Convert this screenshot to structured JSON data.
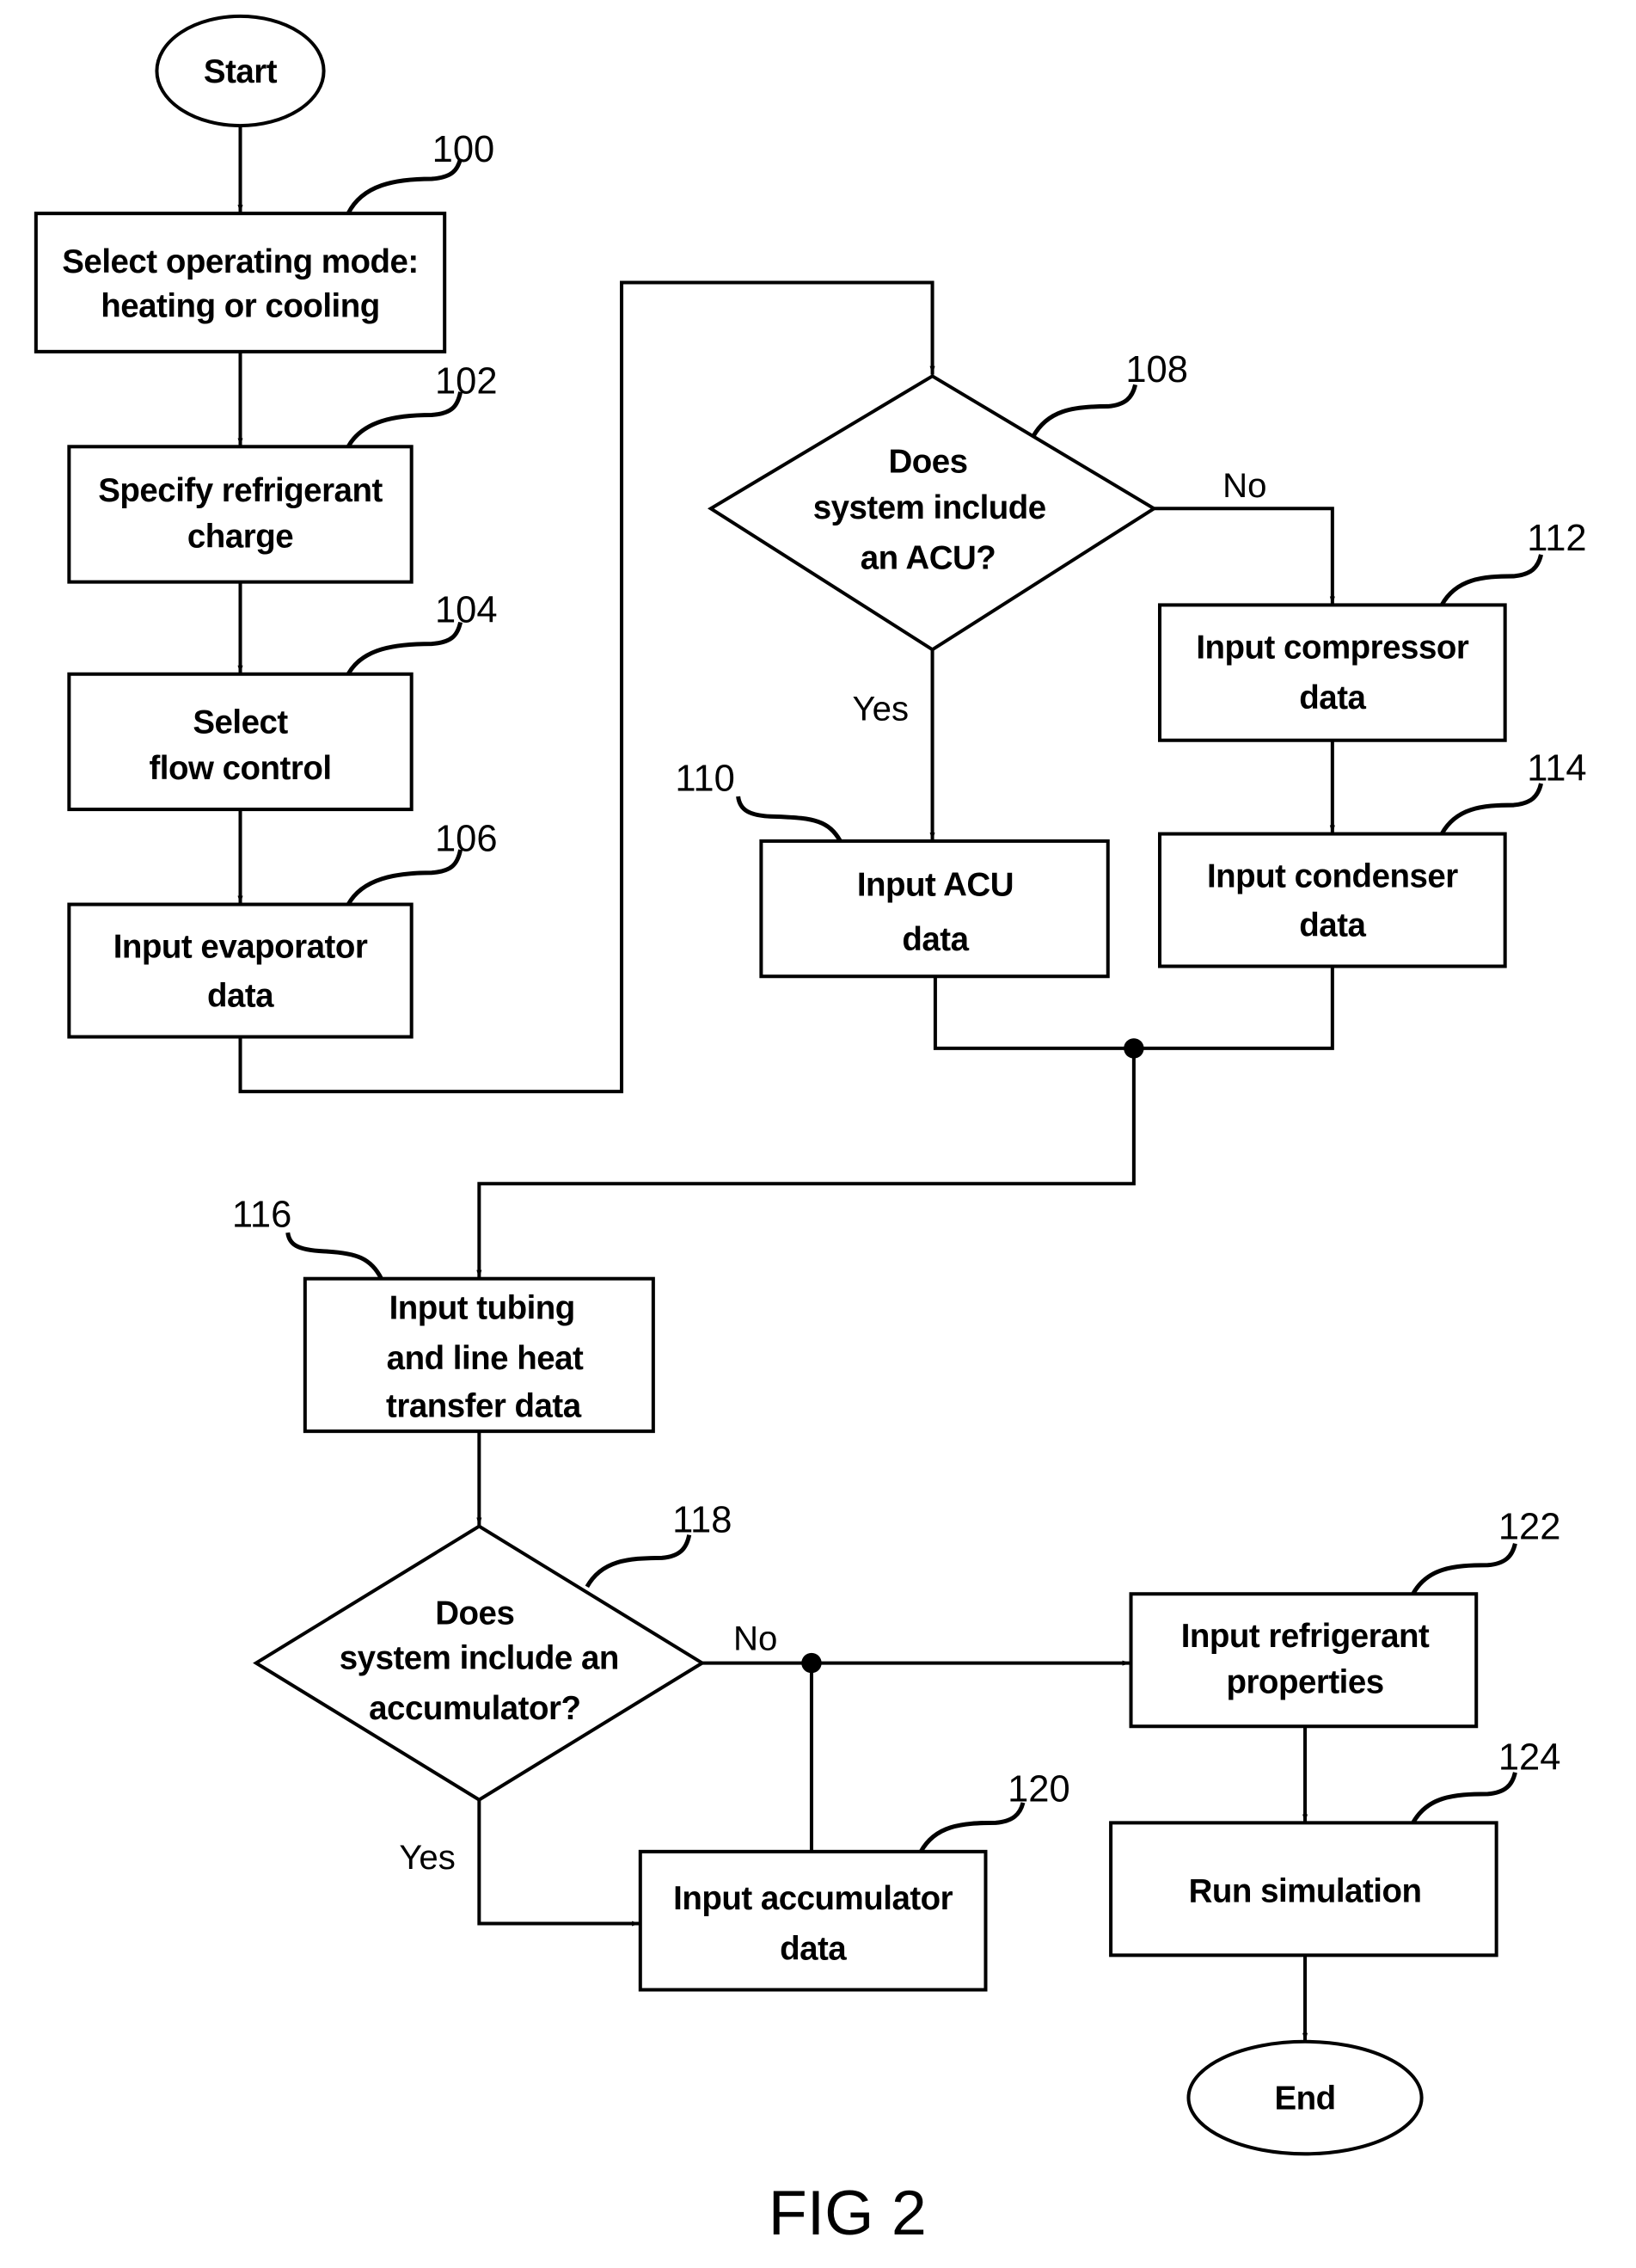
{
  "figure": {
    "caption": "FIG 2",
    "terminals": {
      "start": "Start",
      "end": "End"
    },
    "steps": [
      {
        "ref": "100",
        "lines": [
          "Select operating mode:",
          "heating or cooling"
        ]
      },
      {
        "ref": "102",
        "lines": [
          "Specify refrigerant",
          "charge"
        ]
      },
      {
        "ref": "104",
        "lines": [
          "Select",
          "flow control"
        ]
      },
      {
        "ref": "106",
        "lines": [
          "Input evaporator",
          "data"
        ]
      },
      {
        "ref": "108",
        "lines": [
          "Does",
          "system include",
          "an ACU?"
        ]
      },
      {
        "ref": "110",
        "lines": [
          "Input ACU",
          "data"
        ]
      },
      {
        "ref": "112",
        "lines": [
          "Input compressor",
          "data"
        ]
      },
      {
        "ref": "114",
        "lines": [
          "Input condenser",
          "data"
        ]
      },
      {
        "ref": "116",
        "lines": [
          "Input tubing",
          "and line heat",
          "transfer data"
        ]
      },
      {
        "ref": "118",
        "lines": [
          "Does",
          "system include an",
          "accumulator?"
        ]
      },
      {
        "ref": "120",
        "lines": [
          "Input accumulator",
          "data"
        ]
      },
      {
        "ref": "122",
        "lines": [
          "Input refrigerant",
          "properties"
        ]
      },
      {
        "ref": "124",
        "lines": [
          "Run simulation"
        ]
      }
    ],
    "branch_labels": {
      "d108_no": "No",
      "d108_yes": "Yes",
      "d118_no": "No",
      "d118_yes": "Yes"
    }
  }
}
